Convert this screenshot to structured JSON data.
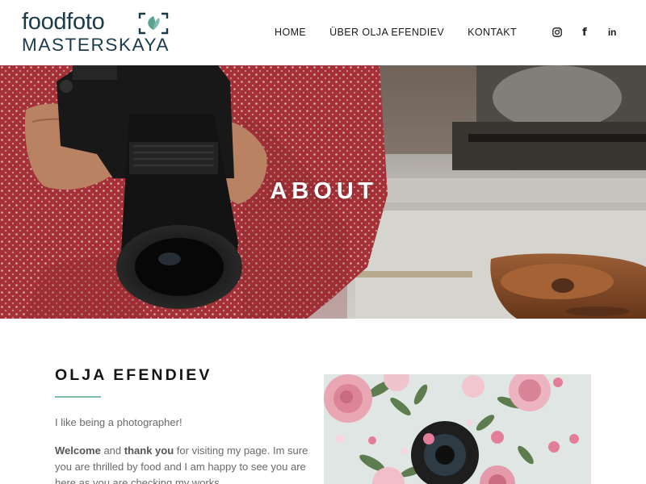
{
  "brand": {
    "line1": "foodfoto",
    "line2": "MASTERSKAYA",
    "color": "#1c3b4a",
    "mark": "camera-frame-leaf-icon"
  },
  "nav": {
    "items": [
      "HOME",
      "ÜBER OLJA EFENDIEV",
      "KONTAKT"
    ],
    "social": [
      "instagram-icon",
      "facebook-icon",
      "linkedin-icon"
    ],
    "facebook_glyph": "f",
    "linkedin_glyph": "in"
  },
  "hero": {
    "title": "ABOUT"
  },
  "about": {
    "name": "OLJA EFENDIEV",
    "accent_color": "#7fbcae",
    "intro": "I like being a photographer!",
    "bio": {
      "welcome": "Welcome",
      "and": " and ",
      "thank_you": "thank you",
      "rest": " for visiting my page. Im sure you are thrilled by food and I am happy to see you are here as you are checking my works."
    }
  }
}
